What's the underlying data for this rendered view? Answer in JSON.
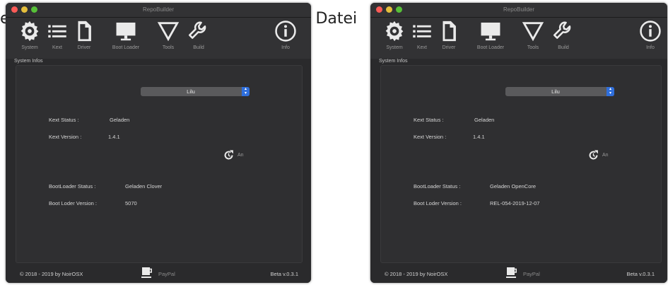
{
  "background_text": {
    "left_fragment": "e",
    "right_fragment": "o Datei"
  },
  "colors": {
    "red": "#fc5b57",
    "yellow": "#e5bf3c",
    "green": "#57c038",
    "accent": "#2f6fdc"
  },
  "windows": [
    {
      "title": "RepoBuilder",
      "toolbar": [
        {
          "label": "System",
          "icon": "gear-icon"
        },
        {
          "label": "Kext",
          "icon": "list-icon"
        },
        {
          "label": "Driver",
          "icon": "document-icon"
        },
        {
          "label": "Boot Loader",
          "icon": "monitor-icon"
        },
        {
          "label": "Tools",
          "icon": "triangle-icon"
        },
        {
          "label": "Build",
          "icon": "wrench-icon"
        },
        {
          "label": "Info",
          "icon": "info-icon"
        }
      ],
      "section_label": "System Infos",
      "dropdown_value": "Lilu",
      "kext_status_label": "Kext Status :",
      "kext_status_value": "Geladen",
      "kext_version_label": "Kext Version :",
      "kext_version_value": "1.4.1",
      "refresh_label": "An",
      "bootloader_status_label": "BootLoader Status :",
      "bootloader_status_value": "Geladen Clover",
      "boot_version_label": "Boot Loder Version :",
      "boot_version_value": "5070",
      "footer_copyright": "© 2018 - 2019 by NoirOSX",
      "footer_paypal": "PayPal",
      "footer_version": "Beta v.0.3.1"
    },
    {
      "title": "RepoBuilder",
      "toolbar": [
        {
          "label": "System",
          "icon": "gear-icon"
        },
        {
          "label": "Kext",
          "icon": "list-icon"
        },
        {
          "label": "Driver",
          "icon": "document-icon"
        },
        {
          "label": "Boot Loader",
          "icon": "monitor-icon"
        },
        {
          "label": "Tools",
          "icon": "triangle-icon"
        },
        {
          "label": "Build",
          "icon": "wrench-icon"
        },
        {
          "label": "Info",
          "icon": "info-icon"
        }
      ],
      "section_label": "System Infos",
      "dropdown_value": "Lilu",
      "kext_status_label": "Kext Status :",
      "kext_status_value": "Geladen",
      "kext_version_label": "Kext Version :",
      "kext_version_value": "1.4.1",
      "refresh_label": "An",
      "bootloader_status_label": "BootLoader Status :",
      "bootloader_status_value": "Geladen OpenCore",
      "boot_version_label": "Boot Loder Version :",
      "boot_version_value": "REL-054-2019-12-07",
      "footer_copyright": "© 2018 - 2019 by NoirOSX",
      "footer_paypal": "PayPal",
      "footer_version": "Beta v.0.3.1"
    }
  ]
}
